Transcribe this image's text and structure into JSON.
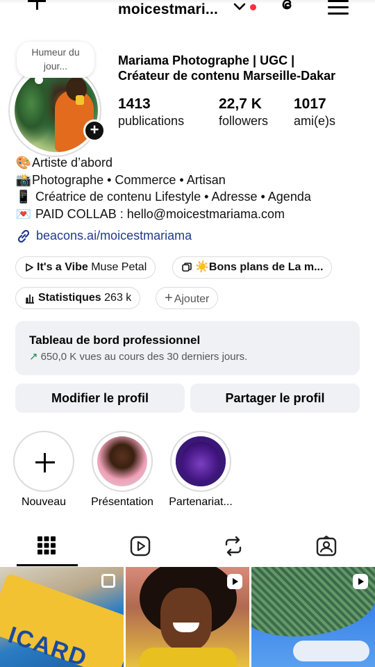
{
  "header": {
    "username": "moicestmari...",
    "notification_dot_color": "#ff2d3c"
  },
  "profile": {
    "note": "Humeur du jour...",
    "full_name_line1": "Mariama Photographe | UGC |",
    "full_name_line2": "Créateur de contenu Marseille-Dakar",
    "stats": [
      {
        "value": "1413",
        "label": "publications"
      },
      {
        "value": "22,7 K",
        "label": "followers"
      },
      {
        "value": "1017",
        "label": "ami(e)s"
      }
    ]
  },
  "bio": {
    "lines": [
      {
        "emoji": "🎨",
        "text": "Artiste d’abord"
      },
      {
        "emoji": "📸",
        "text": "Photographe • Commerce • Artisan"
      },
      {
        "emoji": "📱",
        "text": " Créatrice de contenu Lifestyle • Adresse • Agenda"
      },
      {
        "emoji": "💌",
        "text": " PAID COLLAB : hello@moicestmariama.com"
      }
    ],
    "link": "beacons.ai/moicestmariama"
  },
  "chips": {
    "vibe_bold": "It's a Vibe",
    "vibe_rest": "Muse Petal",
    "bons_plans": "Bons plans de La m...",
    "bons_plans_emoji": "☀️",
    "stats_bold": "Statistiques",
    "stats_value": "263 k",
    "add": "Ajouter"
  },
  "dashboard": {
    "title": "Tableau de bord professionnel",
    "subtitle": "650,0 K vues au cours des 30 derniers jours.",
    "trend_color": "#1a8a4a"
  },
  "buttons": {
    "edit": "Modifier le profil",
    "share": "Partager le profil"
  },
  "highlights": [
    {
      "label": "Nouveau"
    },
    {
      "label": "Présentation"
    },
    {
      "label": "Partenariat..."
    }
  ],
  "tabs": [
    {
      "icon": "grid-icon",
      "active": true
    },
    {
      "icon": "reels-icon",
      "active": false
    },
    {
      "icon": "reposts-icon",
      "active": false
    },
    {
      "icon": "tagged-icon",
      "active": false
    }
  ],
  "grid": {
    "cell1_text": "ICARD"
  }
}
